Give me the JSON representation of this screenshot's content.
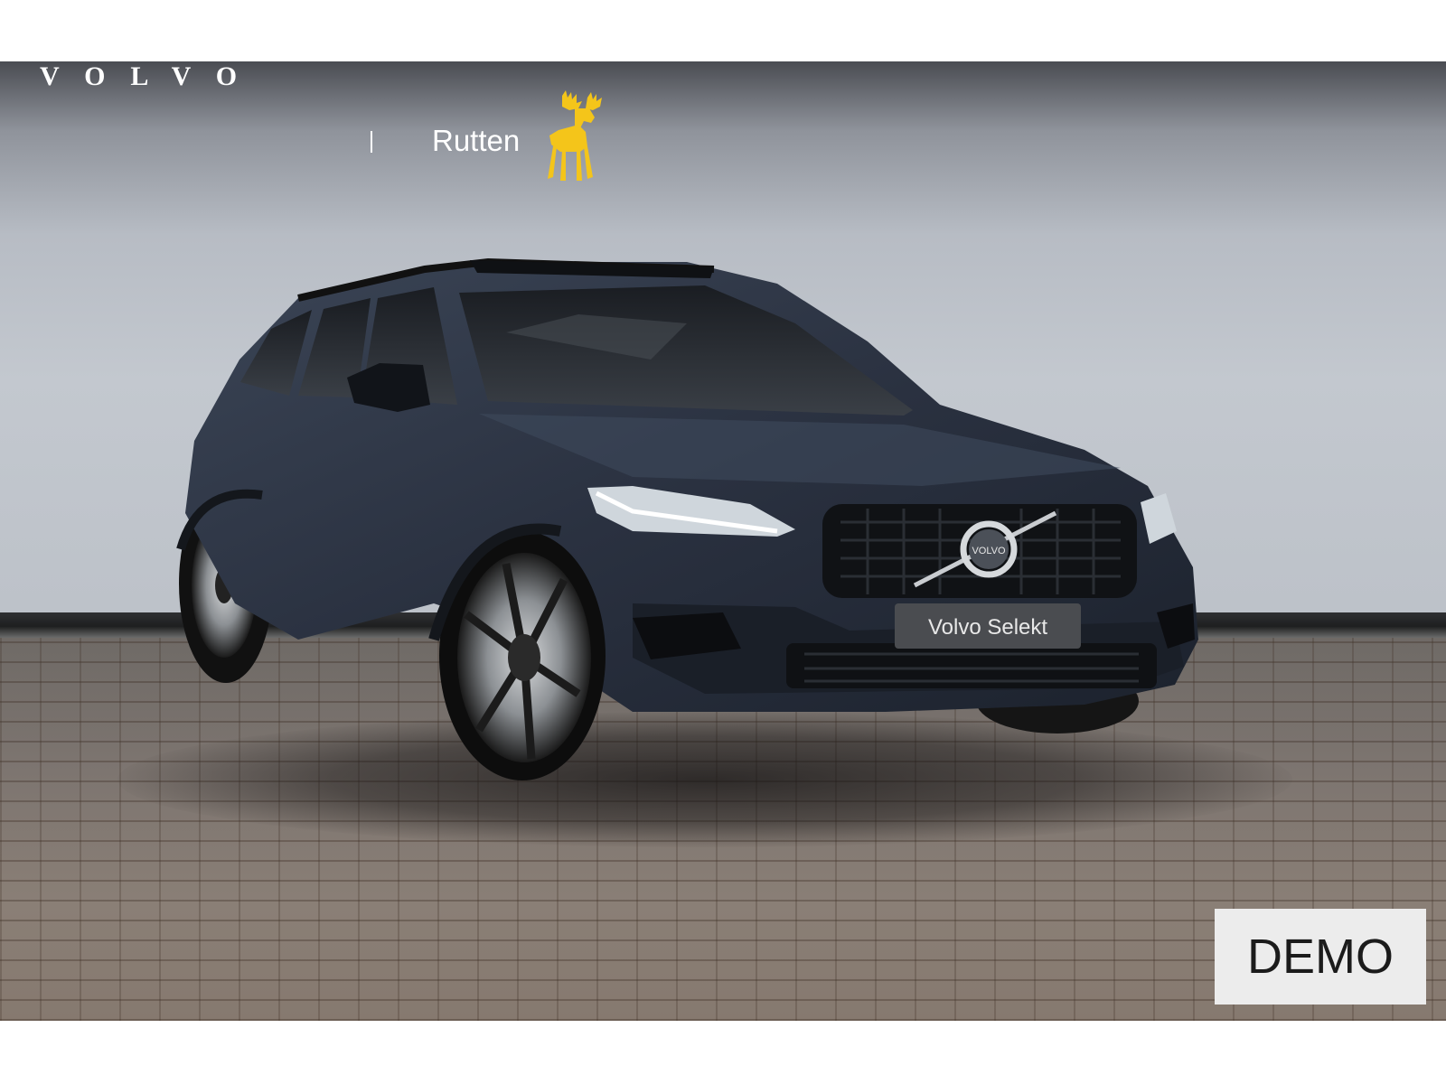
{
  "brand": {
    "wordmark": "VOLVO",
    "dealer": "Rutten"
  },
  "vehicle": {
    "plate_text": "Volvo Selekt",
    "grille_badge": "VOLVO"
  },
  "badge": {
    "label": "DEMO"
  },
  "colors": {
    "moose_yellow": "#f4c51a",
    "car_paint": "#2c3442",
    "badge_bg": "#ececec"
  },
  "icons": {
    "dealer_logo": "moose-icon"
  }
}
